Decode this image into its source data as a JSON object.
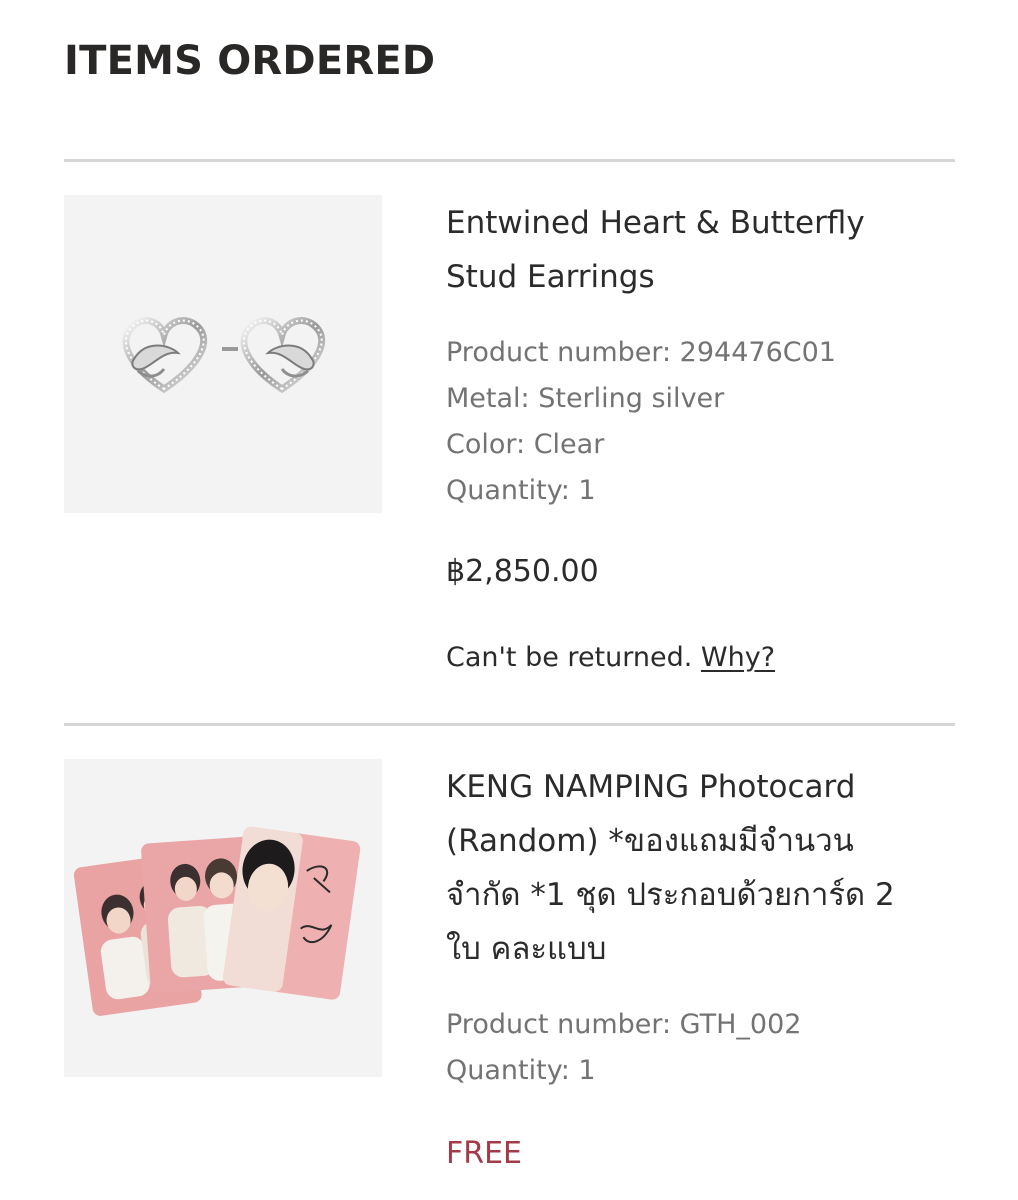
{
  "section": {
    "title": "ITEMS ORDERED"
  },
  "items": [
    {
      "name_line1": "Entwined Heart & Butterfly",
      "name_line2": "Stud Earrings",
      "product_number": "Product number: 294476C01",
      "metal": "Metal: Sterling silver",
      "color": "Color: Clear",
      "quantity": "Quantity: 1",
      "price": "฿2,850.00",
      "return_note": "Can't be returned.",
      "return_link": "Why?",
      "image_icon": "earrings-image"
    },
    {
      "name_line1": "KENG NAMPING Photocard",
      "name_line2": "(Random) *ของแถมมีจำนวน",
      "name_line3": "จำกัด *1 ชุด ประกอบด้วยการ์ด 2",
      "name_line4": "ใบ คละแบบ",
      "product_number": "Product number: GTH_002",
      "quantity": "Quantity: 1",
      "price": "FREE",
      "price_color": "#a33a47",
      "image_icon": "photocard-image"
    }
  ]
}
